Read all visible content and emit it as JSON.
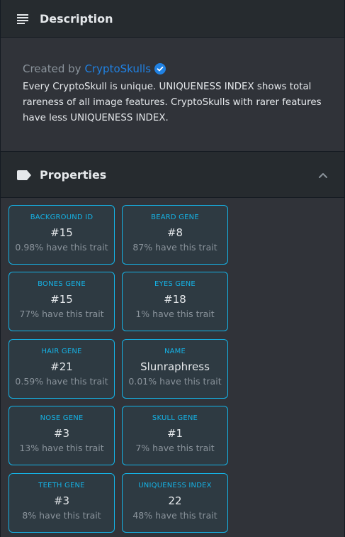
{
  "description": {
    "title": "Description",
    "created_by_label": "Created by",
    "creator": "CryptoSkulls",
    "text": "Every CryptoSkull is unique. UNIQUENESS INDEX shows total rareness of all image features. CryptoSkulls with rarer features have less UNIQUENESS INDEX."
  },
  "properties": {
    "title": "Properties",
    "traits": [
      {
        "type": "BACKGROUND ID",
        "value": "#15",
        "rarity": "0.98% have this trait"
      },
      {
        "type": "BEARD GENE",
        "value": "#8",
        "rarity": "87% have this trait"
      },
      {
        "type": "BONES GENE",
        "value": "#15",
        "rarity": "77% have this trait"
      },
      {
        "type": "EYES GENE",
        "value": "#18",
        "rarity": "1% have this trait"
      },
      {
        "type": "HAIR GENE",
        "value": "#21",
        "rarity": "0.59% have this trait"
      },
      {
        "type": "NAME",
        "value": "Slunraphress",
        "rarity": "0.01% have this trait"
      },
      {
        "type": "NOSE GENE",
        "value": "#3",
        "rarity": "13% have this trait"
      },
      {
        "type": "SKULL GENE",
        "value": "#1",
        "rarity": "7% have this trait"
      },
      {
        "type": "TEETH GENE",
        "value": "#3",
        "rarity": "8% have this trait"
      },
      {
        "type": "UNIQUENESS INDEX",
        "value": "22",
        "rarity": "48% have this trait"
      }
    ]
  },
  "colors": {
    "accent": "#15b2e5",
    "link": "#2081e2",
    "panel_bg": "#303339",
    "header_bg": "#262b2f"
  },
  "icons": {
    "description": "subject-icon",
    "properties": "label-icon",
    "collapse": "chevron-up-icon",
    "verified": "verified-badge-icon"
  }
}
